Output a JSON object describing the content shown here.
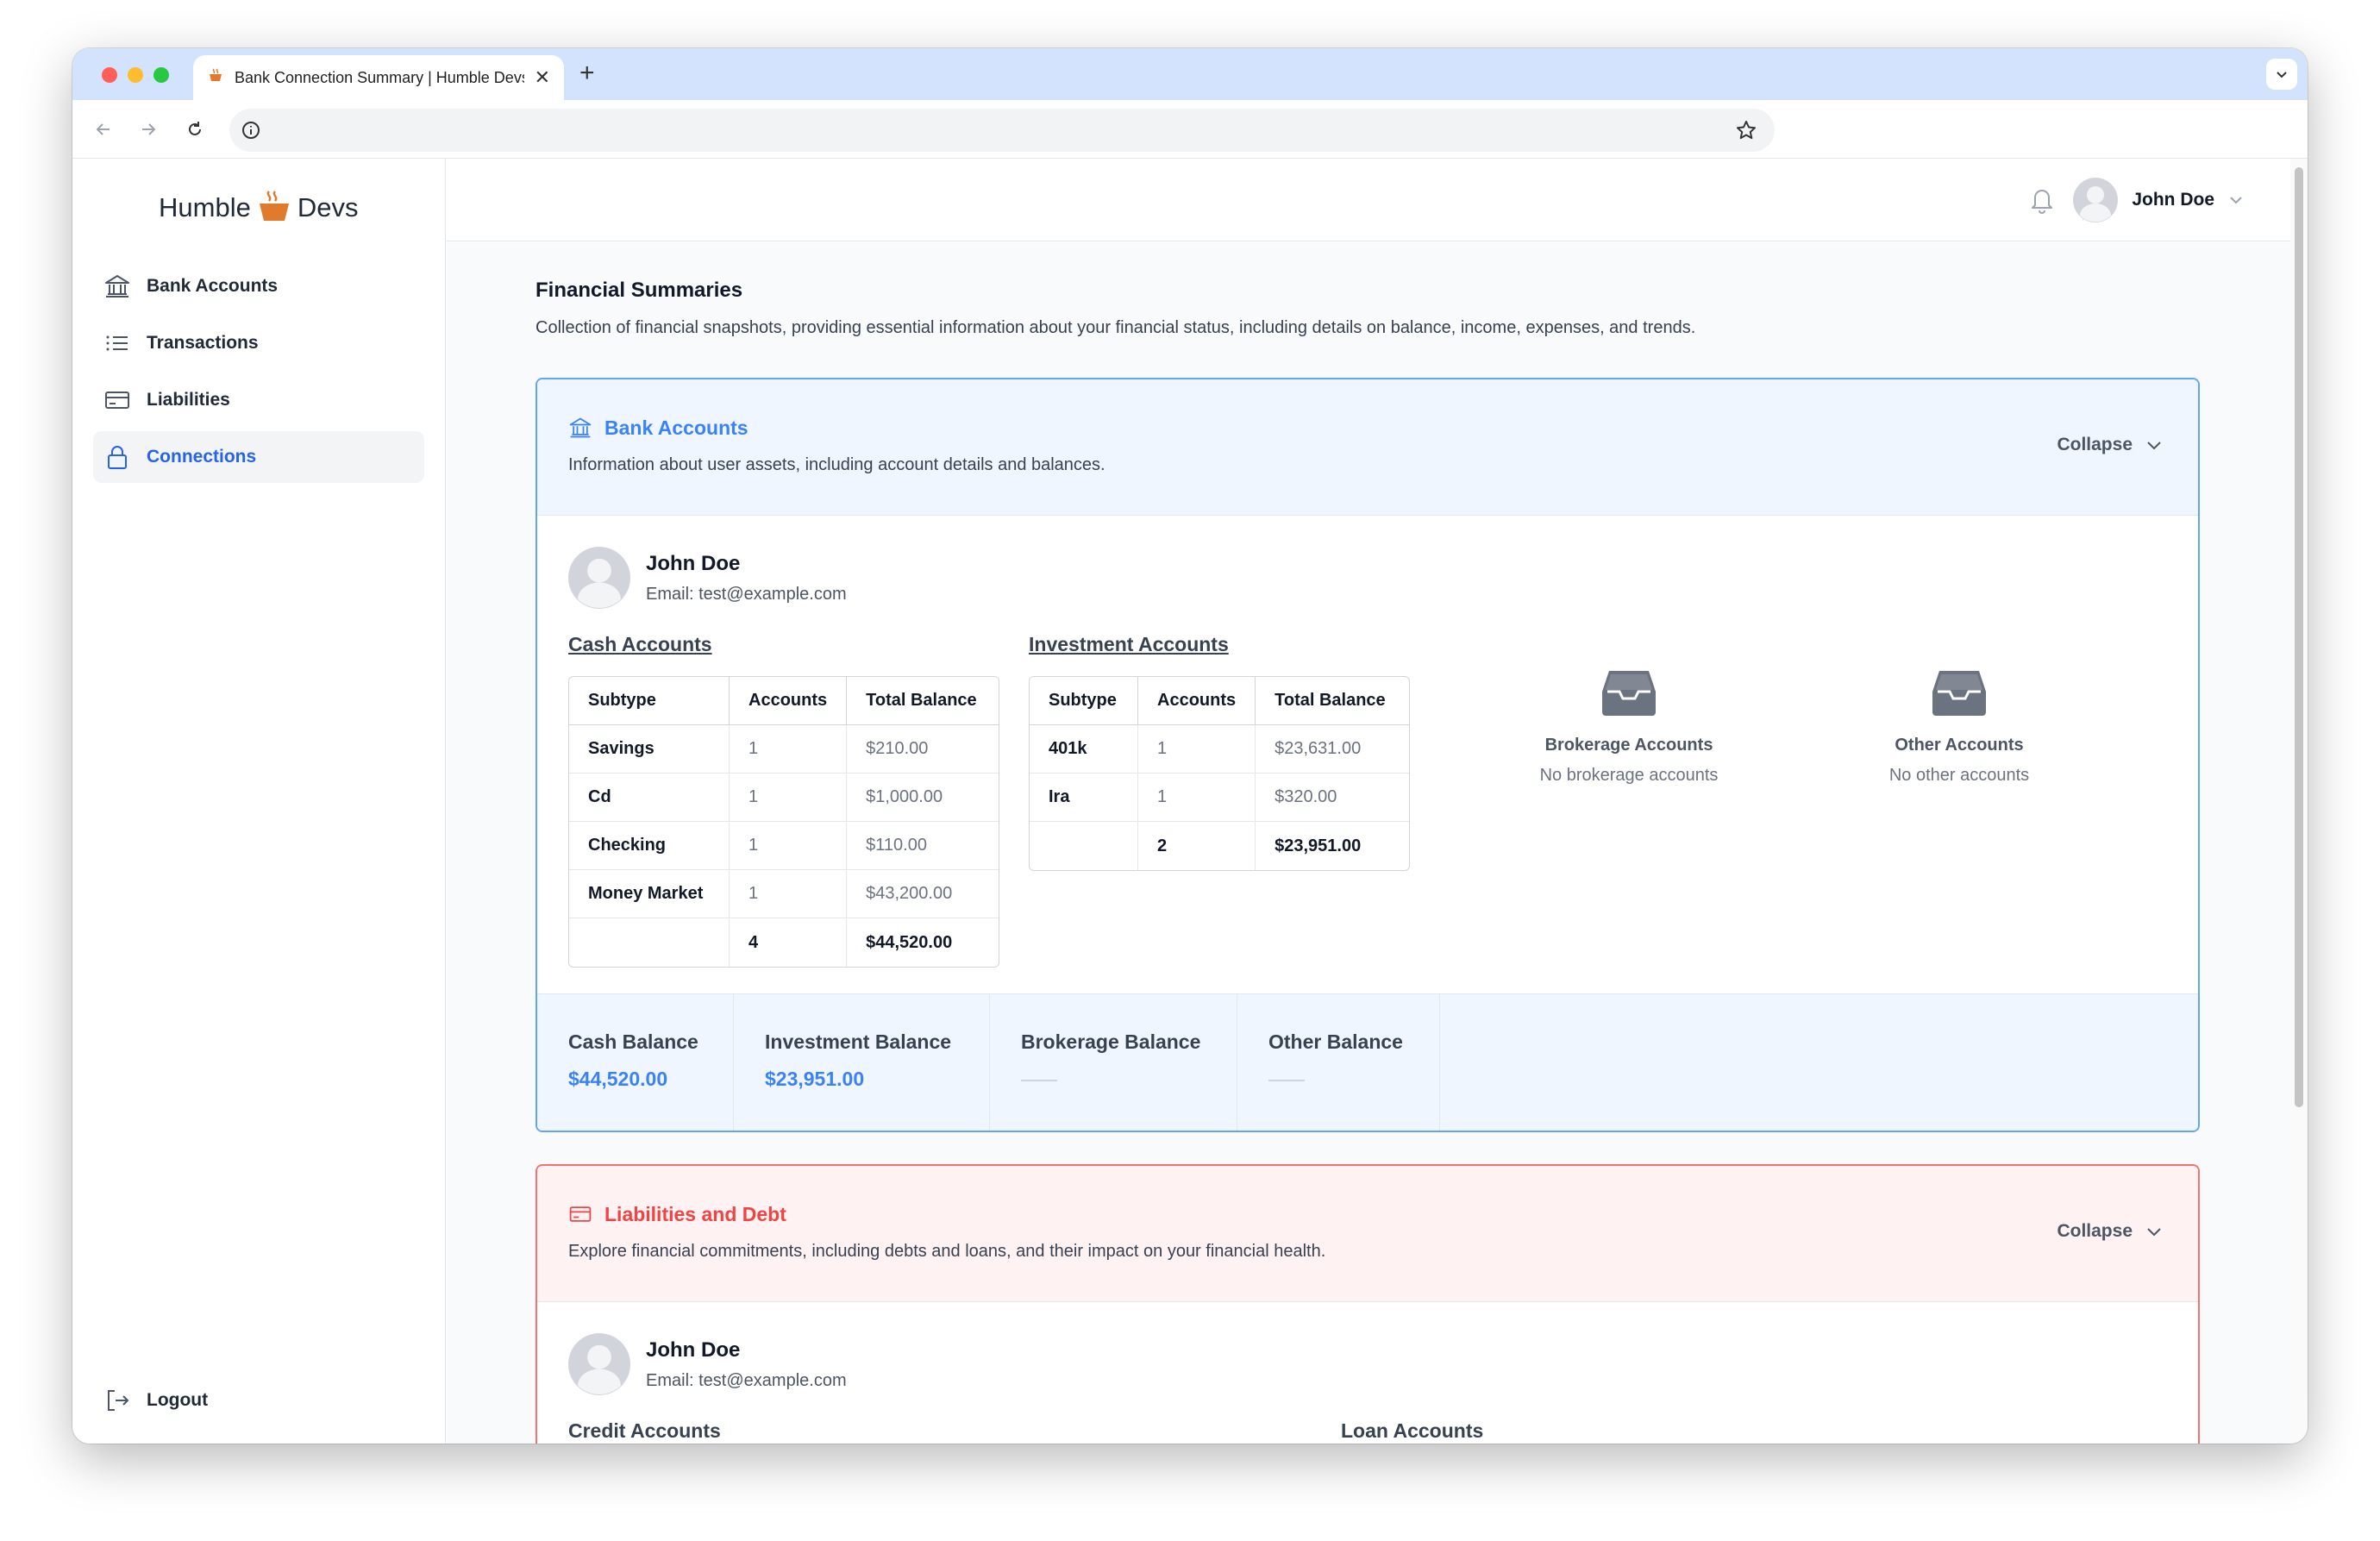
{
  "browser": {
    "tab_title": "Bank Connection Summary | Humble Devs",
    "tab_close": "✕",
    "new_tab": "+",
    "address": ""
  },
  "app": {
    "logo_left": "Humble",
    "logo_right": "Devs"
  },
  "sidebar": {
    "items": [
      {
        "label": "Bank Accounts",
        "icon": "bank-icon"
      },
      {
        "label": "Transactions",
        "icon": "list-icon"
      },
      {
        "label": "Liabilities",
        "icon": "credit-card-icon"
      },
      {
        "label": "Connections",
        "icon": "lock-icon",
        "active": true
      }
    ],
    "logout": "Logout"
  },
  "header": {
    "user_name": "John Doe"
  },
  "page": {
    "title": "Financial Summaries",
    "description": "Collection of financial snapshots, providing essential information about your financial status, including details on balance, income, expenses, and trends."
  },
  "bank_card": {
    "title": "Bank Accounts",
    "description": "Information about user assets, including account details and balances.",
    "collapse": "Collapse",
    "user_name": "John Doe",
    "user_email": "Email: test@example.com",
    "cash": {
      "title": "Cash Accounts",
      "headers": [
        "Subtype",
        "Accounts",
        "Total Balance"
      ],
      "rows": [
        [
          "Savings",
          "1",
          "$210.00"
        ],
        [
          "Cd",
          "1",
          "$1,000.00"
        ],
        [
          "Checking",
          "1",
          "$110.00"
        ],
        [
          "Money Market",
          "1",
          "$43,200.00"
        ]
      ],
      "total": [
        "",
        "4",
        "$44,520.00"
      ]
    },
    "investment": {
      "title": "Investment Accounts",
      "headers": [
        "Subtype",
        "Accounts",
        "Total Balance"
      ],
      "rows": [
        [
          "401k",
          "1",
          "$23,631.00"
        ],
        [
          "Ira",
          "1",
          "$320.00"
        ]
      ],
      "total": [
        "",
        "2",
        "$23,951.00"
      ]
    },
    "brokerage": {
      "title": "Brokerage Accounts",
      "empty": "No brokerage accounts"
    },
    "other": {
      "title": "Other Accounts",
      "empty": "No other accounts"
    },
    "balances": {
      "cash_label": "Cash Balance",
      "cash_value": "$44,520.00",
      "investment_label": "Investment Balance",
      "investment_value": "$23,951.00",
      "brokerage_label": "Brokerage Balance",
      "other_label": "Other Balance"
    }
  },
  "liabilities_card": {
    "title": "Liabilities and Debt",
    "description": "Explore financial commitments, including debts and loans, and their impact on your financial health.",
    "collapse": "Collapse",
    "user_name": "John Doe",
    "user_email": "Email: test@example.com",
    "credit_title": "Credit Accounts",
    "loan_title": "Loan Accounts"
  },
  "colors": {
    "accent": "#3b82f6",
    "danger": "#ef4444",
    "blue_bg": "#eff6ff",
    "red_bg": "#fef2f2"
  }
}
